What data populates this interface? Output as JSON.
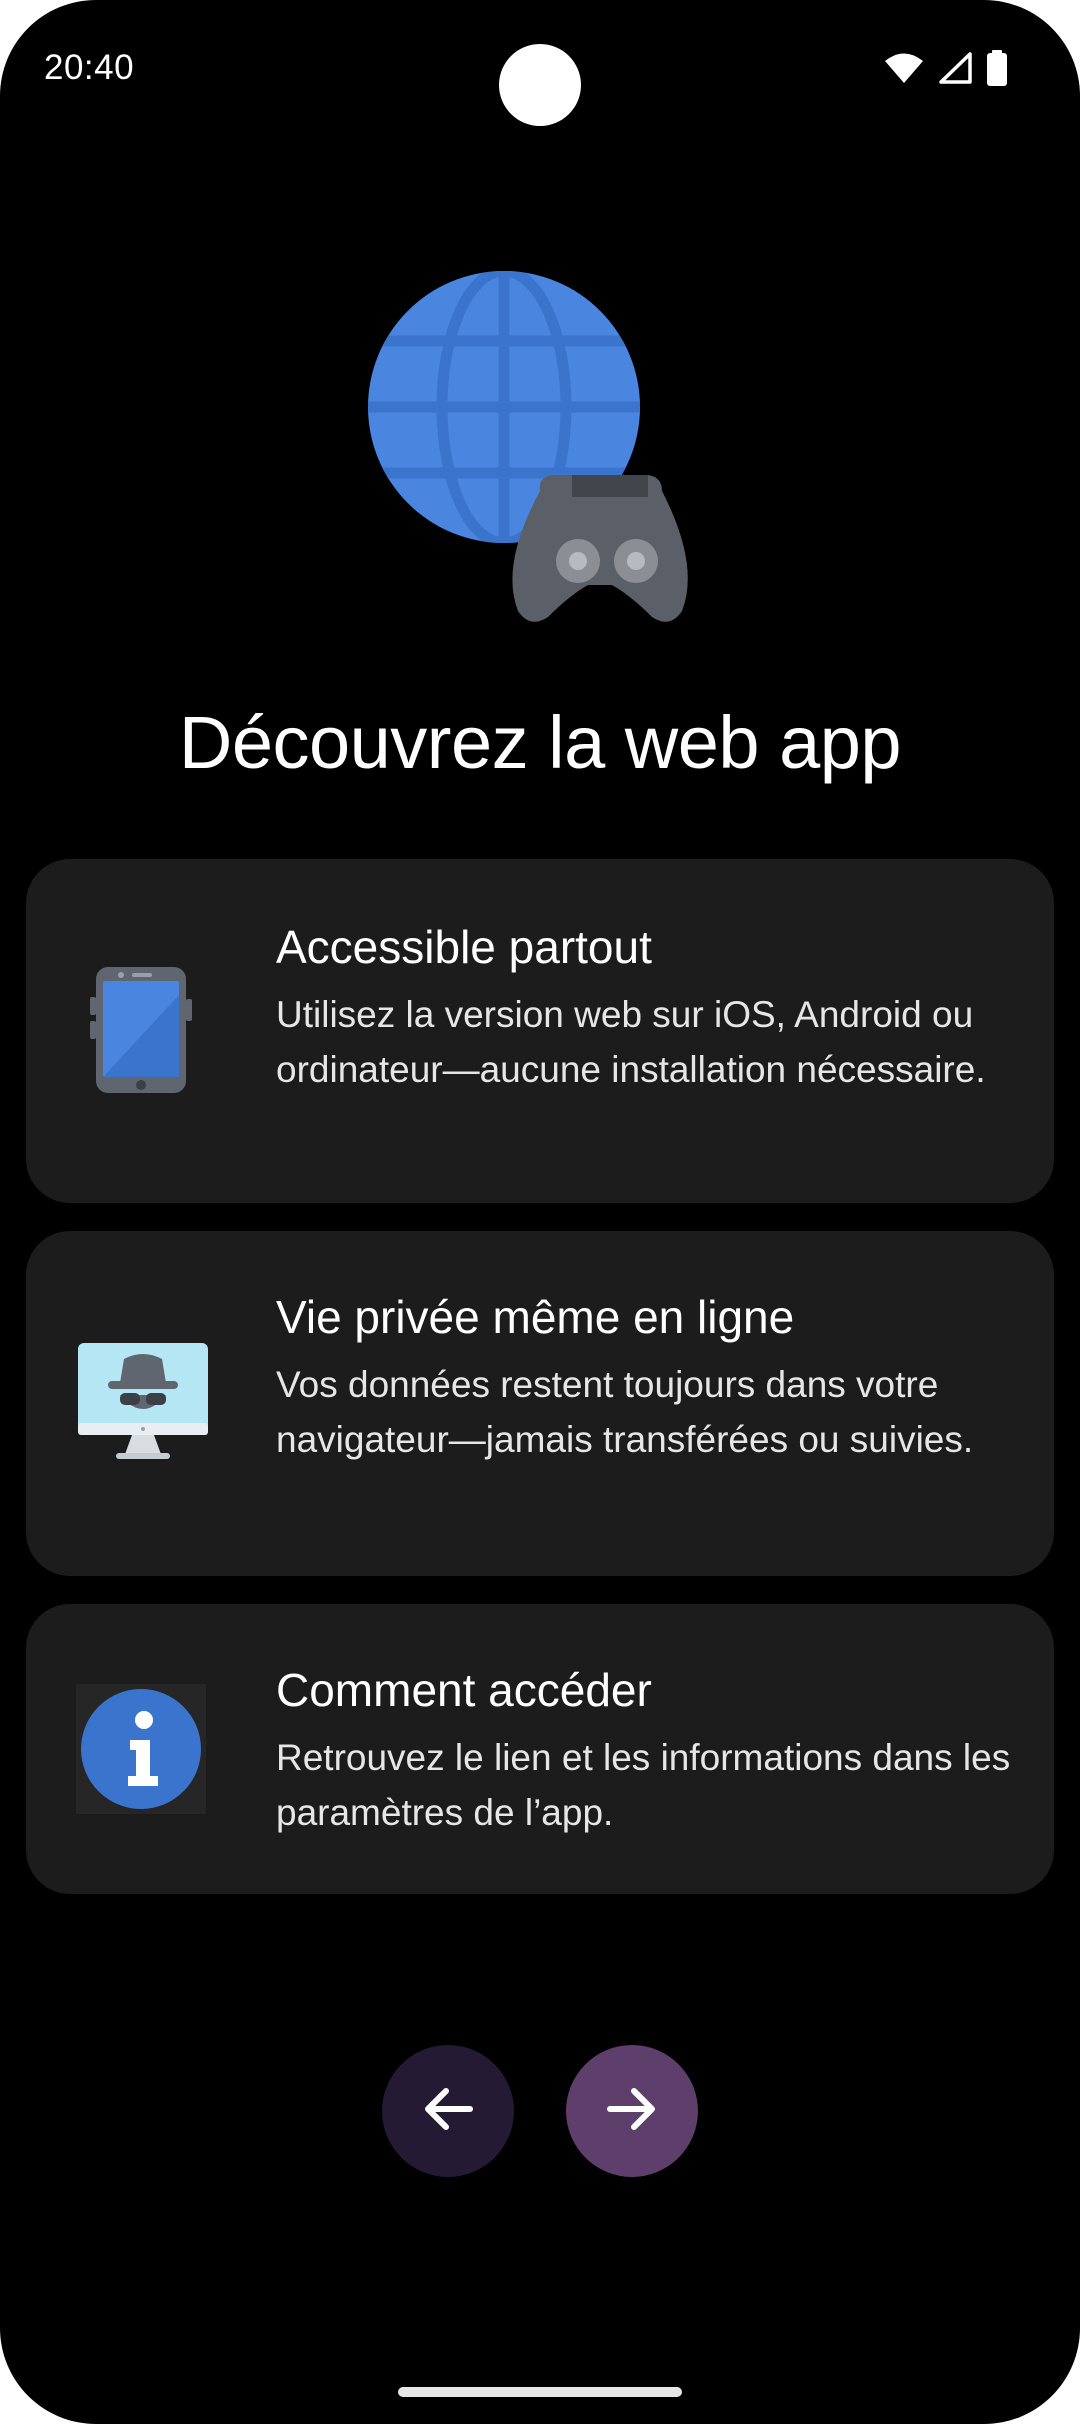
{
  "status_bar": {
    "time": "20:40",
    "icons": [
      "wifi-icon",
      "cellular-signal-icon",
      "battery-icon"
    ]
  },
  "hero": {
    "icons": [
      "globe-icon",
      "gamepad-icon"
    ],
    "colors": {
      "globe": "#4a86e0",
      "gamepad": "#5b6068"
    }
  },
  "title": "Découvrez la web app",
  "cards": [
    {
      "icon": "smartphone-icon",
      "title": "Accessible partout",
      "description": "Utilisez la version web sur iOS, Android ou ordinateur—aucune installation nécessaire."
    },
    {
      "icon": "incognito-monitor-icon",
      "title": "Vie privée même en ligne",
      "description": "Vos données restent toujours dans votre navigateur—jamais transférées ou suivies."
    },
    {
      "icon": "info-icon",
      "title": "Comment accéder",
      "description": "Retrouvez le lien et les informations dans les paramètres de l’app."
    }
  ],
  "navigation": {
    "back_icon": "arrow-left-icon",
    "next_icon": "arrow-right-icon",
    "colors": {
      "back": "#241a33",
      "next": "#5e3e6b"
    }
  },
  "colors": {
    "background": "#000000",
    "card_background": "#1c1c1c",
    "text": "#ffffff"
  }
}
